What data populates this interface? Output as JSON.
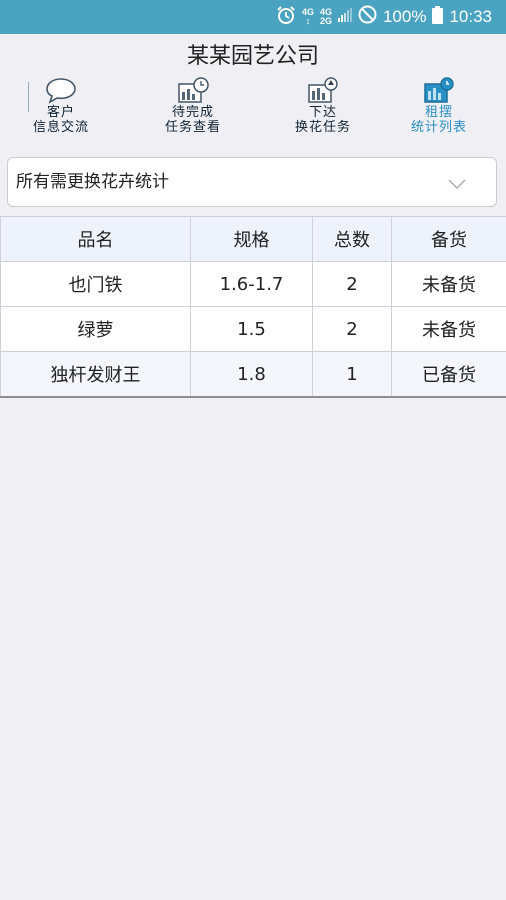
{
  "status_bar": {
    "net1_top": "4G",
    "net1_bottom": "↕",
    "net2_top": "4G",
    "net2_bottom": "2G",
    "battery_pct": "100%",
    "time": "10:33",
    "background": "#4aa3c0"
  },
  "header": {
    "title": "某某园艺公司"
  },
  "nav": [
    {
      "line1": "客户",
      "line2": "信息交流",
      "icon": "chat-bubble-icon"
    },
    {
      "line1": "待完成",
      "line2": "任务查看",
      "icon": "clock-chart-icon"
    },
    {
      "line1": "下达",
      "line2": "换花任务",
      "icon": "chart-upload-icon"
    },
    {
      "line1": "租摆",
      "line2": "统计列表",
      "icon": "stats-list-icon",
      "active": true
    }
  ],
  "filter": {
    "selected": "所有需更换花卉统计"
  },
  "table": {
    "headers": [
      "品名",
      "规格",
      "总数",
      "备货"
    ],
    "rows": [
      [
        "也门铁",
        "1.6-1.7",
        "2",
        "未备货"
      ],
      [
        "绿萝",
        "1.5",
        "2",
        "未备货"
      ],
      [
        "独杆发财王",
        "1.8",
        "1",
        "已备货"
      ]
    ]
  },
  "colors": {
    "accent": "#2a8fc4",
    "page_bg": "#efeff4",
    "header_row_bg": "#eef3fb"
  }
}
